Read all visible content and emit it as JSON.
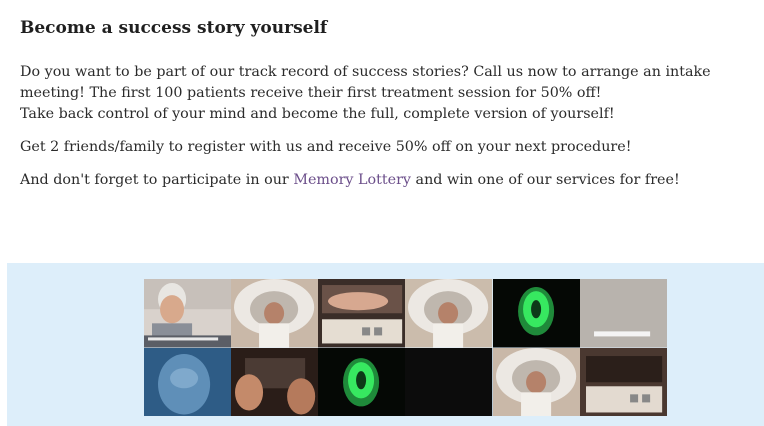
{
  "section": {
    "title": "Become a success story yourself",
    "p1_line1": "Do you want to be part of our track record of success stories? Call us now to arrange an intake",
    "p1_line2": "meeting! The first 100 patients receive their first treatment session for 50% off!",
    "p1_line3": "Take back control of your mind and become the full, complete version of yourself!",
    "p2": "Get 2 friends/family to register with us and receive 50% off on your next procedure!",
    "p3_before": "And don't forget to participate in our ",
    "p3_link": "Memory Lottery",
    "p3_after": " and win one of our services for free!"
  },
  "colors": {
    "banner_bg": "#ddeefa",
    "link": "#6b4e8a",
    "brain_green": "#3dff6a"
  },
  "collage_tiles": [
    {
      "row": 1,
      "col": 1,
      "depicts": "woman-face"
    },
    {
      "row": 1,
      "col": 2,
      "depicts": "mri-scanner-patient"
    },
    {
      "row": 1,
      "col": 3,
      "depicts": "hand-on-tape"
    },
    {
      "row": 1,
      "col": 4,
      "depicts": "mri-scanner-patient"
    },
    {
      "row": 1,
      "col": 5,
      "depicts": "green-brain-scan"
    },
    {
      "row": 1,
      "col": 6,
      "depicts": "grey-panel"
    },
    {
      "row": 2,
      "col": 1,
      "depicts": "blue-face"
    },
    {
      "row": 2,
      "col": 2,
      "depicts": "hands-holding-device"
    },
    {
      "row": 2,
      "col": 3,
      "depicts": "green-brain-scan"
    },
    {
      "row": 2,
      "col": 4,
      "depicts": "black-panel"
    },
    {
      "row": 2,
      "col": 5,
      "depicts": "mri-scanner-patient"
    },
    {
      "row": 2,
      "col": 6,
      "depicts": "tape-device"
    }
  ]
}
